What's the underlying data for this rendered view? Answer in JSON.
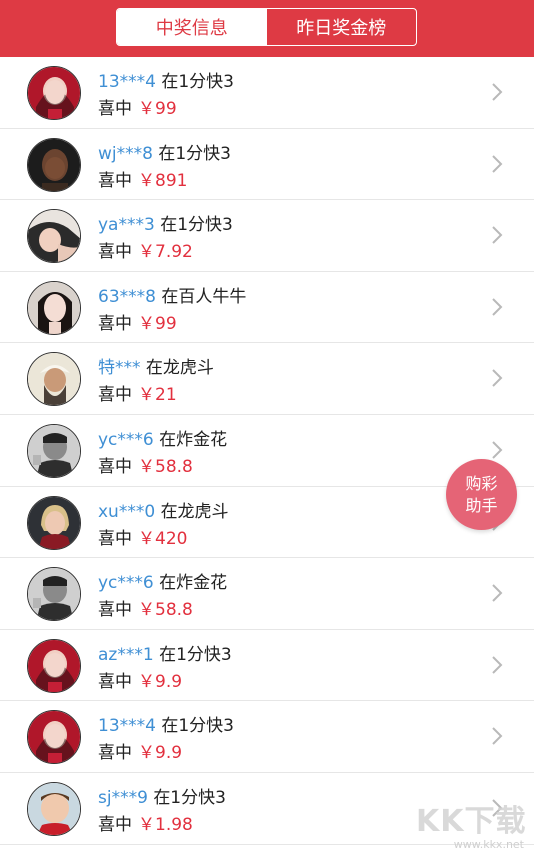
{
  "header": {
    "tabs": [
      {
        "label": "中奖信息",
        "active": true
      },
      {
        "label": "昨日奖金榜",
        "active": false
      }
    ],
    "accent": "#de3a44"
  },
  "rows": [
    {
      "user": "13***4",
      "game": "在1分快3",
      "prefix": "喜中",
      "amount": "￥99",
      "avatar": "avatar-woman-red-icon"
    },
    {
      "user": "wj***8",
      "game": "在1分快3",
      "prefix": "喜中",
      "amount": "￥891",
      "avatar": "avatar-man-dark-icon"
    },
    {
      "user": "ya***3",
      "game": "在1分快3",
      "prefix": "喜中",
      "amount": "￥7.92",
      "avatar": "avatar-woman-pose-icon"
    },
    {
      "user": "63***8",
      "game": "在百人牛牛",
      "prefix": "喜中",
      "amount": "￥99",
      "avatar": "avatar-woman-portrait-icon"
    },
    {
      "user": "特***",
      "game": "在龙虎斗",
      "prefix": "喜中",
      "amount": "￥21",
      "avatar": "avatar-man-turban-icon"
    },
    {
      "user": "yc***6",
      "game": "在炸金花",
      "prefix": "喜中",
      "amount": "￥58.8",
      "avatar": "avatar-man-bw-icon"
    },
    {
      "user": "xu***0",
      "game": "在龙虎斗",
      "prefix": "喜中",
      "amount": "￥420",
      "avatar": "avatar-woman-blonde-icon"
    },
    {
      "user": "yc***6",
      "game": "在炸金花",
      "prefix": "喜中",
      "amount": "￥58.8",
      "avatar": "avatar-man-bw-icon"
    },
    {
      "user": "az***1",
      "game": "在1分快3",
      "prefix": "喜中",
      "amount": "￥9.9",
      "avatar": "avatar-woman-red-icon"
    },
    {
      "user": "13***4",
      "game": "在1分快3",
      "prefix": "喜中",
      "amount": "￥9.9",
      "avatar": "avatar-woman-red-icon"
    },
    {
      "user": "sj***9",
      "game": "在1分快3",
      "prefix": "喜中",
      "amount": "￥1.98",
      "avatar": "avatar-child-icon"
    }
  ],
  "fab": {
    "line1": "购彩",
    "line2": "助手",
    "color": "#e56476"
  },
  "watermark": {
    "brand": "KK下载",
    "url": "www.kkx.net"
  },
  "colors": {
    "username": "#3f8fd4",
    "amount": "#e2303e"
  }
}
